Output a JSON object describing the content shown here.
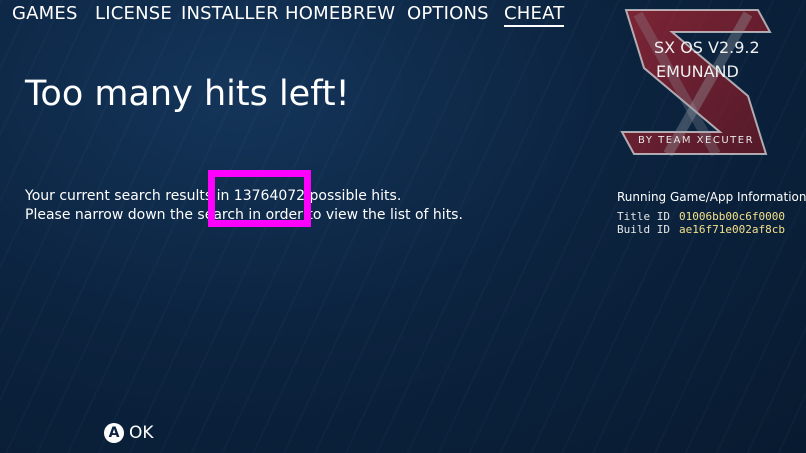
{
  "nav": {
    "tabs": [
      {
        "label": "GAMES"
      },
      {
        "label": "LICENSE"
      },
      {
        "label": "INSTALLER"
      },
      {
        "label": "HOMEBREW"
      },
      {
        "label": "OPTIONS"
      },
      {
        "label": "CHEAT"
      }
    ],
    "active_tab": "CHEAT"
  },
  "logo": {
    "version": "SX OS V2.9.2",
    "mode": "EMUNAND",
    "by": "BY TEAM XECUTER",
    "brand_red": "#c0202a",
    "icon": "sx-logo-icon"
  },
  "main": {
    "headline": "Too many hits left!",
    "message_line1": "Your current search results in 13764072 possible hits.",
    "message_line2": "Please narrow down the search in order to view the list of hits."
  },
  "annotation": {
    "highlight_color": "#ff00ff"
  },
  "info": {
    "title": "Running Game/App Information",
    "title_id_label": "Title ID",
    "title_id_value": "01006bb00c6f0000",
    "build_id_label": "Build ID",
    "build_id_value": "ae16f71e002af8cb"
  },
  "footer": {
    "button_glyph": "A",
    "button_label": "OK",
    "icon": "a-button-icon"
  }
}
